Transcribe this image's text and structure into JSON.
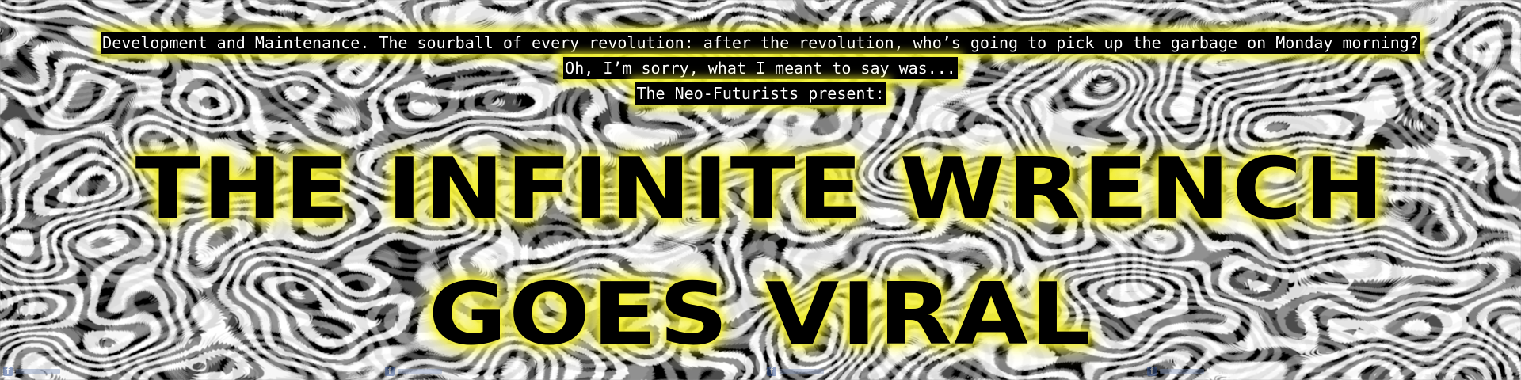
{
  "intro": {
    "line1": "Development and Maintenance. The sourball of every revolution: after the revolution, who’s going to pick up the garbage on Monday morning?",
    "line2": "Oh, I’m sorry, what I meant to say was...",
    "line3": "The Neo-Futurists present:"
  },
  "title": {
    "line1": "THE INFINITE WRENCH",
    "line2": "GOES VIRAL"
  },
  "colors": {
    "glow": "#f4f034",
    "text": "#000000",
    "intro_bg": "#000000",
    "intro_text": "#ffffff"
  },
  "background": {
    "pattern": "black-and-white psychedelic zebra swirl"
  },
  "footer": {
    "icons": [
      "facebook-icon",
      "facebook-icon",
      "facebook-icon",
      "facebook-icon"
    ]
  }
}
